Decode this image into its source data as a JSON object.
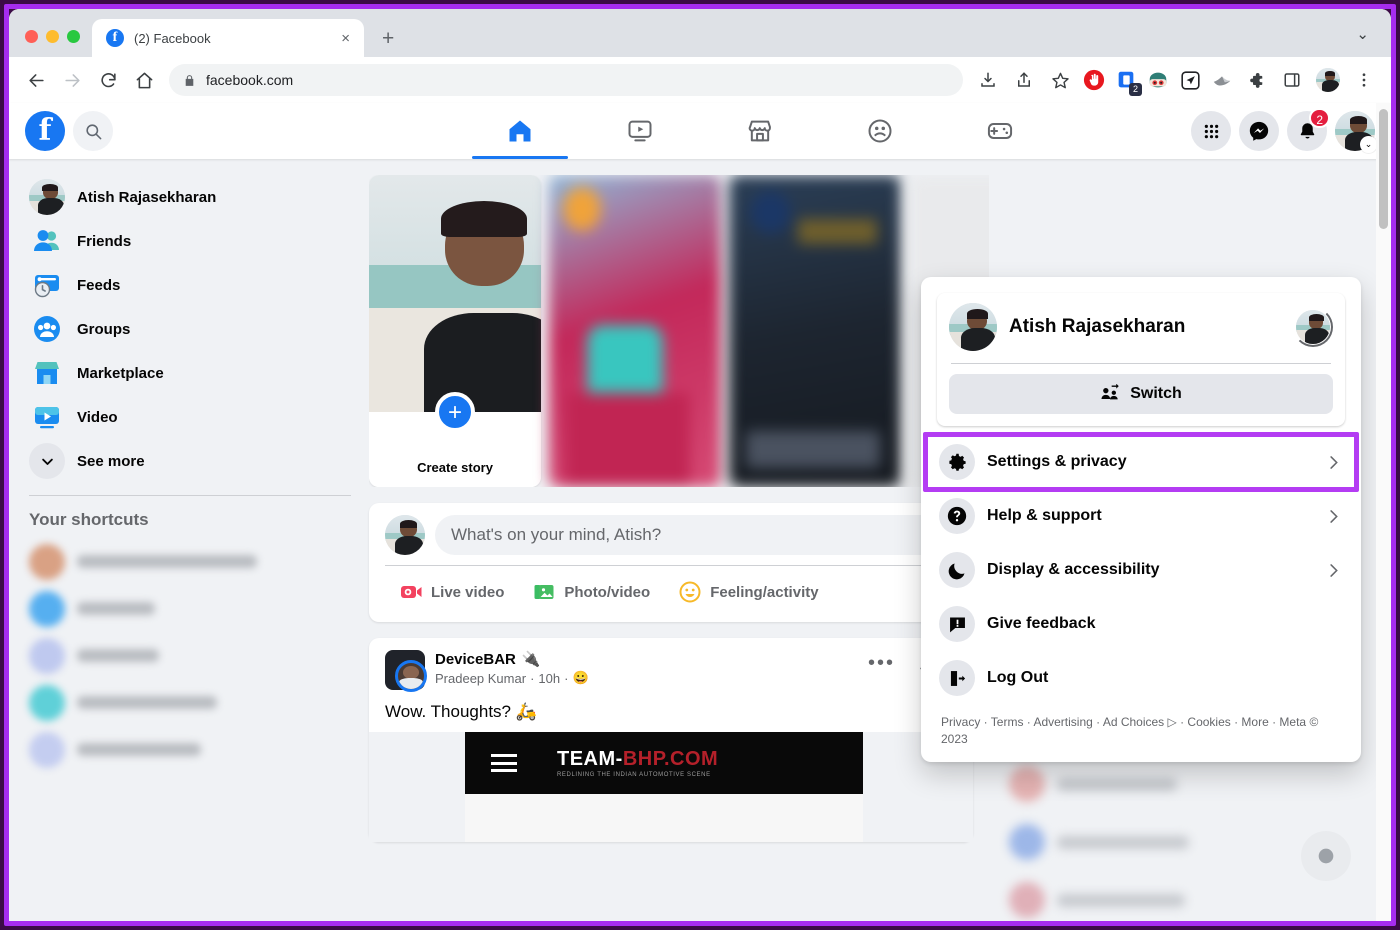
{
  "browser": {
    "tab": {
      "title": "(2) Facebook",
      "favicon": "facebook-icon",
      "close": "×"
    },
    "new_tab": "+",
    "window_chevron": "⌄",
    "nav": {
      "back": "←",
      "forward": "→",
      "reload": "⟳",
      "home": "⌂"
    },
    "omnibox": {
      "lock": "🔒",
      "url": "facebook.com"
    },
    "toolbar_icons": [
      "download-icon",
      "share-icon",
      "bookmark-star-icon",
      "adblock-icon",
      "tab-manager-icon",
      "extension-face-icon",
      "send-icon",
      "extension-bird-icon",
      "puzzle-extensions-icon",
      "side-panel-icon",
      "profile-avatar",
      "kebab-menu-icon"
    ],
    "tab_manager_count": "2"
  },
  "fbnav": {
    "logo": "facebook-logo",
    "search": "search-icon",
    "tabs": [
      {
        "name": "home",
        "icon": "home-icon",
        "active": true
      },
      {
        "name": "video",
        "icon": "video-icon",
        "active": false
      },
      {
        "name": "marketplace",
        "icon": "marketplace-icon",
        "active": false
      },
      {
        "name": "groups",
        "icon": "groups-icon",
        "active": false
      },
      {
        "name": "gaming",
        "icon": "gaming-icon",
        "active": false
      }
    ],
    "menu_icon": "grid-menu-icon",
    "messenger_icon": "messenger-icon",
    "notifications_icon": "bell-icon",
    "notifications_count": "2",
    "account_chevron": "⌄"
  },
  "sidebar": {
    "items": [
      {
        "label": "Atish Rajasekharan",
        "icon": "user-avatar"
      },
      {
        "label": "Friends",
        "icon": "friends-icon"
      },
      {
        "label": "Feeds",
        "icon": "feeds-icon"
      },
      {
        "label": "Groups",
        "icon": "groups-icon"
      },
      {
        "label": "Marketplace",
        "icon": "marketplace-icon"
      },
      {
        "label": "Video",
        "icon": "video-icon"
      },
      {
        "label": "See more",
        "icon": "chevron-down-icon"
      }
    ],
    "shortcuts_title": "Your shortcuts",
    "shortcuts_count": 5
  },
  "stories": {
    "create": {
      "label": "Create story",
      "plus": "+"
    },
    "count": 4
  },
  "composer": {
    "placeholder": "What's on your mind, Atish?",
    "actions": [
      {
        "label": "Live video",
        "icon": "live-video-icon"
      },
      {
        "label": "Photo/video",
        "icon": "photo-video-icon"
      },
      {
        "label": "Feeling/activity",
        "icon": "feeling-icon"
      }
    ]
  },
  "post": {
    "page_name": "DeviceBAR",
    "page_emoji": "🔌",
    "author": "Pradeep Kumar",
    "time": "10h",
    "audience_icon": "😀",
    "text": "Wow. Thoughts? 🛵",
    "more_icon": "•••",
    "collapse_icon": "^",
    "media": {
      "logo_main": "TEAM-",
      "logo_accent": "BHP.COM",
      "tagline": "REDLINING THE INDIAN AUTOMOTIVE SCENE",
      "menu_icon": "hamburger-icon"
    }
  },
  "dropdown": {
    "profile": {
      "name": "Atish Rajasekharan",
      "badge_icon": "switch-profile-icon"
    },
    "switch": {
      "label": "Switch",
      "icon": "switch-accounts-icon"
    },
    "items": [
      {
        "label": "Settings & privacy",
        "icon": "gear-icon",
        "arrow": "›",
        "highlighted": true
      },
      {
        "label": "Help & support",
        "icon": "question-circle-icon",
        "arrow": "›",
        "highlighted": false
      },
      {
        "label": "Display & accessibility",
        "icon": "moon-icon",
        "arrow": "›",
        "highlighted": false
      },
      {
        "label": "Give feedback",
        "icon": "feedback-icon",
        "arrow": "",
        "highlighted": false
      },
      {
        "label": "Log Out",
        "icon": "logout-icon",
        "arrow": "",
        "highlighted": false
      }
    ],
    "footer": "Privacy · Terms · Advertising · Ad Choices ▷ · Cookies · More · Meta © 2023"
  },
  "colors": {
    "annotation_purple": "#b43cf3",
    "fb_blue": "#1877f2",
    "badge_red": "#e41e3f",
    "page_bg": "#f0f2f5"
  }
}
